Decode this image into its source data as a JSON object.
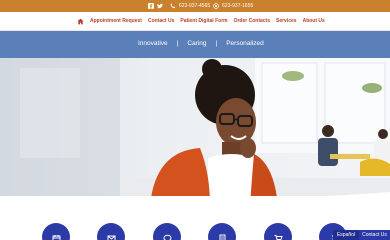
{
  "topbar": {
    "social": [
      "facebook-icon",
      "twitter-icon"
    ],
    "phone": "623-937-4565",
    "fax": "623-937-1655",
    "bg_color": "#c9812e"
  },
  "nav": {
    "items": [
      {
        "label": "Appointment Request"
      },
      {
        "label": "Contact Us"
      },
      {
        "label": "Patient Digital Form"
      },
      {
        "label": "Order Contacts"
      },
      {
        "label": "Services"
      },
      {
        "label": "About Us"
      }
    ],
    "text_color": "#b8402c"
  },
  "tagline": {
    "items": [
      "Innovative",
      "Caring",
      "Personalized"
    ],
    "separator": "|",
    "bg_color": "#5b7fb8"
  },
  "feature_icons": [
    "calendar-icon",
    "mail-icon",
    "chat-icon",
    "form-icon",
    "cart-icon",
    "info-icon"
  ],
  "widgets": {
    "language": "Español",
    "contact": "Contact Us"
  },
  "accent_color": "#2b3aa6"
}
